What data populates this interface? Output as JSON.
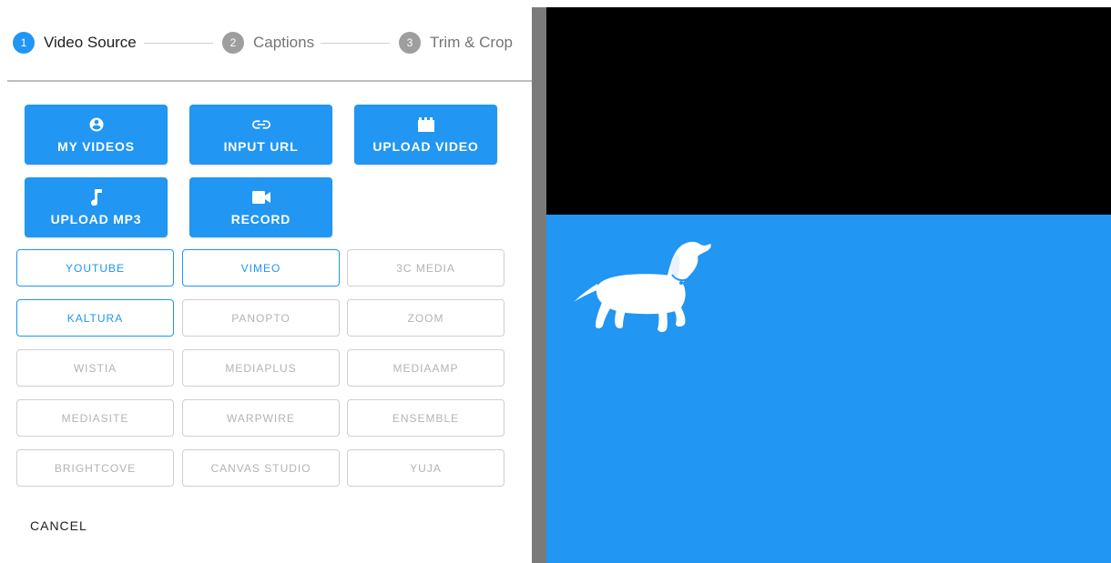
{
  "stepper": {
    "steps": [
      {
        "number": "1",
        "label": "Video Source",
        "state": "active"
      },
      {
        "number": "2",
        "label": "Captions",
        "state": "inactive"
      },
      {
        "number": "3",
        "label": "Trim & Crop",
        "state": "inactive"
      }
    ]
  },
  "primary_buttons": [
    {
      "label": "MY VIDEOS",
      "icon": "account-circle-icon"
    },
    {
      "label": "INPUT URL",
      "icon": "link-icon"
    },
    {
      "label": "UPLOAD VIDEO",
      "icon": "clapperboard-icon"
    },
    {
      "label": "UPLOAD MP3",
      "icon": "music-note-icon"
    },
    {
      "label": "RECORD",
      "icon": "video-camera-icon"
    }
  ],
  "providers": [
    {
      "label": "YOUTUBE",
      "enabled": true
    },
    {
      "label": "VIMEO",
      "enabled": true
    },
    {
      "label": "3C MEDIA",
      "enabled": false
    },
    {
      "label": "KALTURA",
      "enabled": true
    },
    {
      "label": "PANOPTO",
      "enabled": false
    },
    {
      "label": "ZOOM",
      "enabled": false
    },
    {
      "label": "WISTIA",
      "enabled": false
    },
    {
      "label": "MEDIAPLUS",
      "enabled": false
    },
    {
      "label": "MEDIAAMP",
      "enabled": false
    },
    {
      "label": "MEDIASITE",
      "enabled": false
    },
    {
      "label": "WARPWIRE",
      "enabled": false
    },
    {
      "label": "ENSEMBLE",
      "enabled": false
    },
    {
      "label": "BRIGHTCOVE",
      "enabled": false
    },
    {
      "label": "CANVAS STUDIO",
      "enabled": false
    },
    {
      "label": "YUJA",
      "enabled": false
    }
  ],
  "cancel_label": "CANCEL",
  "colors": {
    "accent": "#2196f3",
    "inactive_step": "#9e9e9e",
    "disabled_text": "#b3b3b3",
    "video_top": "#000000",
    "divider": "#7a7a7a"
  },
  "preview": {
    "logo": "dachshund-logo"
  }
}
